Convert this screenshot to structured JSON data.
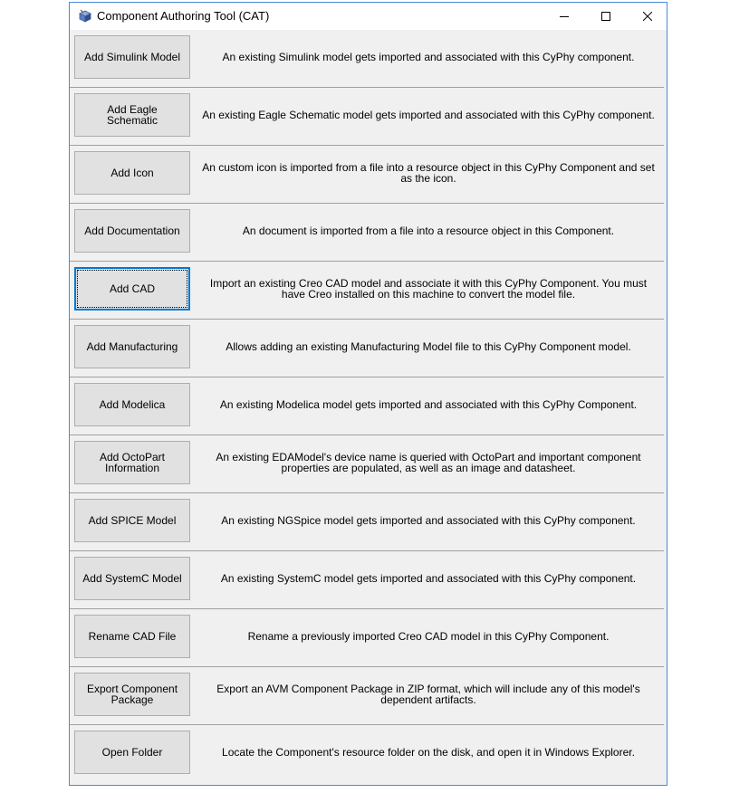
{
  "window": {
    "title": "Component Authoring Tool (CAT)",
    "accent_color": "#0078d7",
    "controls": {
      "minimize_icon": "minimize-icon",
      "maximize_icon": "maximize-icon",
      "close_icon": "close-icon"
    }
  },
  "rows": [
    {
      "button": "Add Simulink Model",
      "description": "An existing Simulink model gets imported and associated with this CyPhy component."
    },
    {
      "button": "Add Eagle Schematic",
      "description": "An existing Eagle Schematic model gets imported and associated with this CyPhy component."
    },
    {
      "button": "Add Icon",
      "description": "An custom icon is imported from a file into a resource object in this CyPhy Component and set as the icon."
    },
    {
      "button": "Add Documentation",
      "description": "An document is imported from a file into a resource object in this Component."
    },
    {
      "button": "Add CAD",
      "description": "Import an existing Creo CAD model and associate it with this CyPhy Component.  You must have Creo installed on this machine to convert the model file.",
      "focused": true
    },
    {
      "button": "Add Manufacturing",
      "description": "Allows adding an existing Manufacturing Model file to this CyPhy Component model."
    },
    {
      "button": "Add Modelica",
      "description": "An existing Modelica model gets imported and associated with this CyPhy Component."
    },
    {
      "button": "Add OctoPart Information",
      "description": "An existing EDAModel's device name is queried with OctoPart and important component properties are populated, as well as an image and datasheet."
    },
    {
      "button": "Add SPICE Model",
      "description": "An existing NGSpice model gets imported and associated with this CyPhy component."
    },
    {
      "button": "Add SystemC Model",
      "description": "An existing SystemC model gets imported and associated with this CyPhy component."
    },
    {
      "button": "Rename CAD File",
      "description": "Rename a previously imported Creo CAD model in this CyPhy Component."
    },
    {
      "button": "Export Component Package",
      "description": "Export an AVM Component Package in ZIP format, which will include any of this model's dependent artifacts."
    },
    {
      "button": "Open Folder",
      "description": "Locate the Component's resource folder on the disk, and open it in Windows Explorer."
    }
  ]
}
